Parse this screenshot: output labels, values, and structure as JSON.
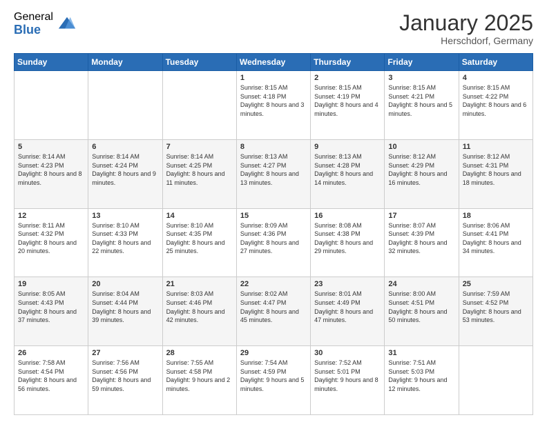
{
  "logo": {
    "general": "General",
    "blue": "Blue"
  },
  "header": {
    "title": "January 2025",
    "location": "Herschdorf, Germany"
  },
  "days_of_week": [
    "Sunday",
    "Monday",
    "Tuesday",
    "Wednesday",
    "Thursday",
    "Friday",
    "Saturday"
  ],
  "weeks": [
    [
      {
        "day": "",
        "sunrise": "",
        "sunset": "",
        "daylight": ""
      },
      {
        "day": "",
        "sunrise": "",
        "sunset": "",
        "daylight": ""
      },
      {
        "day": "",
        "sunrise": "",
        "sunset": "",
        "daylight": ""
      },
      {
        "day": "1",
        "sunrise": "Sunrise: 8:15 AM",
        "sunset": "Sunset: 4:18 PM",
        "daylight": "Daylight: 8 hours and 3 minutes."
      },
      {
        "day": "2",
        "sunrise": "Sunrise: 8:15 AM",
        "sunset": "Sunset: 4:19 PM",
        "daylight": "Daylight: 8 hours and 4 minutes."
      },
      {
        "day": "3",
        "sunrise": "Sunrise: 8:15 AM",
        "sunset": "Sunset: 4:21 PM",
        "daylight": "Daylight: 8 hours and 5 minutes."
      },
      {
        "day": "4",
        "sunrise": "Sunrise: 8:15 AM",
        "sunset": "Sunset: 4:22 PM",
        "daylight": "Daylight: 8 hours and 6 minutes."
      }
    ],
    [
      {
        "day": "5",
        "sunrise": "Sunrise: 8:14 AM",
        "sunset": "Sunset: 4:23 PM",
        "daylight": "Daylight: 8 hours and 8 minutes."
      },
      {
        "day": "6",
        "sunrise": "Sunrise: 8:14 AM",
        "sunset": "Sunset: 4:24 PM",
        "daylight": "Daylight: 8 hours and 9 minutes."
      },
      {
        "day": "7",
        "sunrise": "Sunrise: 8:14 AM",
        "sunset": "Sunset: 4:25 PM",
        "daylight": "Daylight: 8 hours and 11 minutes."
      },
      {
        "day": "8",
        "sunrise": "Sunrise: 8:13 AM",
        "sunset": "Sunset: 4:27 PM",
        "daylight": "Daylight: 8 hours and 13 minutes."
      },
      {
        "day": "9",
        "sunrise": "Sunrise: 8:13 AM",
        "sunset": "Sunset: 4:28 PM",
        "daylight": "Daylight: 8 hours and 14 minutes."
      },
      {
        "day": "10",
        "sunrise": "Sunrise: 8:12 AM",
        "sunset": "Sunset: 4:29 PM",
        "daylight": "Daylight: 8 hours and 16 minutes."
      },
      {
        "day": "11",
        "sunrise": "Sunrise: 8:12 AM",
        "sunset": "Sunset: 4:31 PM",
        "daylight": "Daylight: 8 hours and 18 minutes."
      }
    ],
    [
      {
        "day": "12",
        "sunrise": "Sunrise: 8:11 AM",
        "sunset": "Sunset: 4:32 PM",
        "daylight": "Daylight: 8 hours and 20 minutes."
      },
      {
        "day": "13",
        "sunrise": "Sunrise: 8:10 AM",
        "sunset": "Sunset: 4:33 PM",
        "daylight": "Daylight: 8 hours and 22 minutes."
      },
      {
        "day": "14",
        "sunrise": "Sunrise: 8:10 AM",
        "sunset": "Sunset: 4:35 PM",
        "daylight": "Daylight: 8 hours and 25 minutes."
      },
      {
        "day": "15",
        "sunrise": "Sunrise: 8:09 AM",
        "sunset": "Sunset: 4:36 PM",
        "daylight": "Daylight: 8 hours and 27 minutes."
      },
      {
        "day": "16",
        "sunrise": "Sunrise: 8:08 AM",
        "sunset": "Sunset: 4:38 PM",
        "daylight": "Daylight: 8 hours and 29 minutes."
      },
      {
        "day": "17",
        "sunrise": "Sunrise: 8:07 AM",
        "sunset": "Sunset: 4:39 PM",
        "daylight": "Daylight: 8 hours and 32 minutes."
      },
      {
        "day": "18",
        "sunrise": "Sunrise: 8:06 AM",
        "sunset": "Sunset: 4:41 PM",
        "daylight": "Daylight: 8 hours and 34 minutes."
      }
    ],
    [
      {
        "day": "19",
        "sunrise": "Sunrise: 8:05 AM",
        "sunset": "Sunset: 4:43 PM",
        "daylight": "Daylight: 8 hours and 37 minutes."
      },
      {
        "day": "20",
        "sunrise": "Sunrise: 8:04 AM",
        "sunset": "Sunset: 4:44 PM",
        "daylight": "Daylight: 8 hours and 39 minutes."
      },
      {
        "day": "21",
        "sunrise": "Sunrise: 8:03 AM",
        "sunset": "Sunset: 4:46 PM",
        "daylight": "Daylight: 8 hours and 42 minutes."
      },
      {
        "day": "22",
        "sunrise": "Sunrise: 8:02 AM",
        "sunset": "Sunset: 4:47 PM",
        "daylight": "Daylight: 8 hours and 45 minutes."
      },
      {
        "day": "23",
        "sunrise": "Sunrise: 8:01 AM",
        "sunset": "Sunset: 4:49 PM",
        "daylight": "Daylight: 8 hours and 47 minutes."
      },
      {
        "day": "24",
        "sunrise": "Sunrise: 8:00 AM",
        "sunset": "Sunset: 4:51 PM",
        "daylight": "Daylight: 8 hours and 50 minutes."
      },
      {
        "day": "25",
        "sunrise": "Sunrise: 7:59 AM",
        "sunset": "Sunset: 4:52 PM",
        "daylight": "Daylight: 8 hours and 53 minutes."
      }
    ],
    [
      {
        "day": "26",
        "sunrise": "Sunrise: 7:58 AM",
        "sunset": "Sunset: 4:54 PM",
        "daylight": "Daylight: 8 hours and 56 minutes."
      },
      {
        "day": "27",
        "sunrise": "Sunrise: 7:56 AM",
        "sunset": "Sunset: 4:56 PM",
        "daylight": "Daylight: 8 hours and 59 minutes."
      },
      {
        "day": "28",
        "sunrise": "Sunrise: 7:55 AM",
        "sunset": "Sunset: 4:58 PM",
        "daylight": "Daylight: 9 hours and 2 minutes."
      },
      {
        "day": "29",
        "sunrise": "Sunrise: 7:54 AM",
        "sunset": "Sunset: 4:59 PM",
        "daylight": "Daylight: 9 hours and 5 minutes."
      },
      {
        "day": "30",
        "sunrise": "Sunrise: 7:52 AM",
        "sunset": "Sunset: 5:01 PM",
        "daylight": "Daylight: 9 hours and 8 minutes."
      },
      {
        "day": "31",
        "sunrise": "Sunrise: 7:51 AM",
        "sunset": "Sunset: 5:03 PM",
        "daylight": "Daylight: 9 hours and 12 minutes."
      },
      {
        "day": "",
        "sunrise": "",
        "sunset": "",
        "daylight": ""
      }
    ]
  ]
}
